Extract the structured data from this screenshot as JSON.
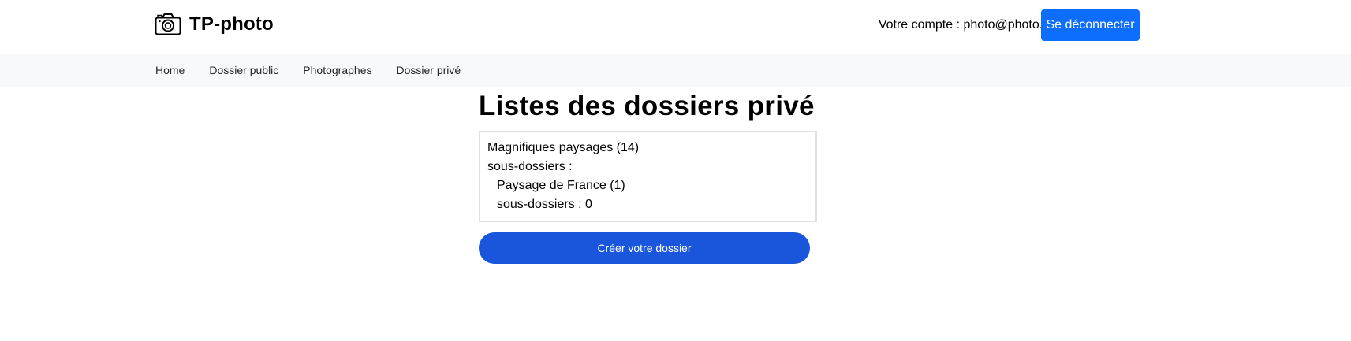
{
  "header": {
    "brand_title": "TP-photo",
    "brand_icon": "camera-icon",
    "account_text": "Votre compte : photo@photo.fr",
    "logout_label": "Se déconnecter",
    "accent_color": "#0d6efd"
  },
  "nav": {
    "items": [
      {
        "label": "Home"
      },
      {
        "label": "Dossier public"
      },
      {
        "label": "Photographes"
      },
      {
        "label": "Dossier privé"
      }
    ]
  },
  "main": {
    "heading": "Listes des dossiers privé",
    "folders": [
      {
        "title": "Magnifiques paysages (14)",
        "subfolders_label": "sous-dossiers :",
        "subfolders": [
          {
            "title": "Paysage de France (1)",
            "subfolders_label": "sous-dossiers : 0"
          }
        ]
      }
    ],
    "create_button_label": "Créer votre dossier",
    "create_button_color": "#1a56db"
  }
}
